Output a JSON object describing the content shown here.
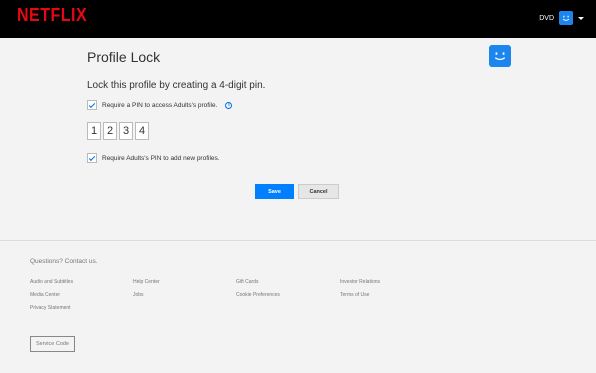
{
  "header": {
    "logo": "NETFLIX",
    "account_name": "DVD",
    "avatar_icon": "smiley-avatar-icon",
    "caret_icon": "caret-down-icon"
  },
  "page": {
    "title": "Profile Lock",
    "subtitle": "Lock this profile by creating a 4-digit pin.",
    "require_pin_label": "Require a PIN to access Adults's profile.",
    "require_pin_checked": true,
    "info_glyph": "i",
    "pin_digits": [
      "1",
      "2",
      "3",
      "4"
    ],
    "new_profiles_label": "Require Adults's PIN to add new profiles.",
    "new_profiles_checked": true,
    "save_label": "Save",
    "cancel_label": "Cancel"
  },
  "footer": {
    "contact": "Questions? Contact us.",
    "links": [
      "Audio and Subtitles",
      "Help Center",
      "Gift Cards",
      "Investor Relations",
      "Media Center",
      "Jobs",
      "Cookie Preferences",
      "Terms of Use",
      "Privacy Statement"
    ],
    "service_code_label": "Service Code"
  },
  "colors": {
    "brand": "#e50914",
    "accent": "#0080ff",
    "avatar": "#1c86ee"
  }
}
